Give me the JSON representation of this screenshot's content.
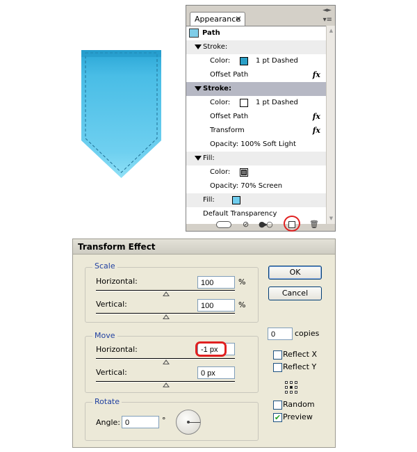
{
  "appearance_panel": {
    "tab_title": "Appearance",
    "close_glyph": "×",
    "double_arrow": "◄►",
    "menu_glyph": "▾≡",
    "path_title": "Path",
    "rows": {
      "stroke1": "Stroke:",
      "stroke1_color_label": "Color:",
      "stroke1_value": "1 pt Dashed",
      "stroke1_offset": "Offset Path",
      "stroke2": "Stroke:",
      "stroke2_color_label": "Color:",
      "stroke2_value": "1 pt Dashed",
      "stroke2_offset": "Offset Path",
      "stroke2_transform": "Transform",
      "stroke2_opacity": "Opacity: 100% Soft Light",
      "fill": "Fill:",
      "fill_color_label": "Color:",
      "fill_opacity": "Opacity: 70% Screen",
      "fill2": "Fill:",
      "default_transparency": "Default Transparency"
    },
    "fx_glyph": "fx",
    "swatch_colors": {
      "stroke1": "#2a9fc7",
      "stroke2": "#ffffff",
      "fill": "#6e6e6e",
      "fill2": "#6fcdee"
    }
  },
  "transform_dialog": {
    "title": "Transform Effect",
    "scale": {
      "label": "Scale",
      "horizontal_label": "Horizontal:",
      "horizontal_value": "100",
      "vertical_label": "Vertical:",
      "vertical_value": "100",
      "unit": "%"
    },
    "move": {
      "label": "Move",
      "horizontal_label": "Horizontal:",
      "horizontal_value": "-1 px",
      "vertical_label": "Vertical:",
      "vertical_value": "0 px"
    },
    "rotate": {
      "label": "Rotate",
      "angle_label": "Angle:",
      "angle_value": "0",
      "degree": "°"
    },
    "ok_label": "OK",
    "cancel_label": "Cancel",
    "copies_value": "0",
    "copies_label": "copies",
    "reflect_x_label": "Reflect X",
    "reflect_y_label": "Reflect Y",
    "random_label": "Random",
    "preview_label": "Preview",
    "preview_checked": true,
    "check_glyph": "✔"
  }
}
